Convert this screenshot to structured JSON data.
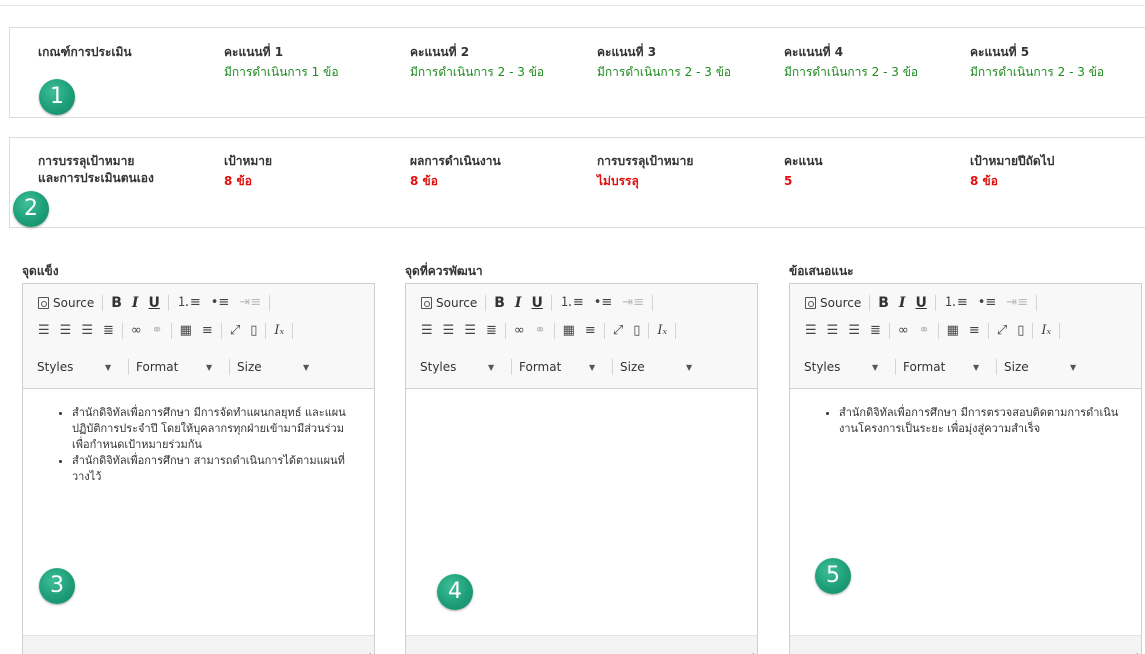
{
  "criteria": {
    "label": "เกณฑ์การประเมิน",
    "scores": [
      {
        "title": "คะแนนที่ 1",
        "desc": "มีการดำเนินการ 1 ข้อ"
      },
      {
        "title": "คะแนนที่ 2",
        "desc": "มีการดำเนินการ 2 - 3 ข้อ"
      },
      {
        "title": "คะแนนที่ 3",
        "desc": "มีการดำเนินการ 2 - 3 ข้อ"
      },
      {
        "title": "คะแนนที่ 4",
        "desc": "มีการดำเนินการ 2 - 3 ข้อ"
      },
      {
        "title": "คะแนนที่ 5",
        "desc": "มีการดำเนินการ 2 - 3 ข้อ"
      }
    ]
  },
  "assessment": {
    "label_line1": "การบรรลุเป้าหมาย",
    "label_line2": "และการประเมินตนเอง",
    "columns": [
      {
        "title": "เป้าหมาย",
        "value": "8 ข้อ"
      },
      {
        "title": "ผลการดำเนินงาน",
        "value": "8 ข้อ"
      },
      {
        "title": "การบรรลุเป้าหมาย",
        "value": "ไม่บรรลุ"
      },
      {
        "title": "คะแนน",
        "value": "5"
      },
      {
        "title": "เป้าหมายปีถัดไป",
        "value": "8 ข้อ"
      }
    ]
  },
  "badges": [
    "1",
    "2",
    "3",
    "4",
    "5"
  ],
  "toolbar": {
    "source": "Source",
    "bold": "B",
    "italic": "I",
    "underline": "U",
    "styles": "Styles",
    "format": "Format",
    "size": "Size",
    "icons": [
      "source-icon",
      "bold-icon",
      "italic-icon",
      "underline-icon",
      "numbered-list-icon",
      "bulleted-list-icon",
      "indent-icon",
      "align-left-icon",
      "align-center-icon",
      "align-right-icon",
      "justify-icon",
      "link-icon",
      "unlink-icon",
      "table-icon",
      "horizontal-line-icon",
      "maximize-icon",
      "show-blocks-icon",
      "remove-format-icon"
    ]
  },
  "editors": [
    {
      "title": "จุดแข็ง",
      "items": [
        "สำนักดิจิทัลเพื่อการศึกษา มีการจัดทำแผนกลยุทธ์ และแผนปฏิบัติการประจำปี  โดยให้บุคลากรทุกฝ่ายเข้ามามีส่วนร่วมเพื่อกำหนดเป้าหมายร่วมกัน",
        "สำนักดิจิทัลเพื่อการศึกษา  สามารถดำเนินการได้ตามแผนที่วางไว้"
      ]
    },
    {
      "title": "จุดที่ควรพัฒนา",
      "items": []
    },
    {
      "title": "ข้อเสนอแนะ",
      "items": [
        "สำนักดิจิทัลเพื่อการศึกษา มีการตรวจสอบติดตามการดำเนินงานโครงการเป็นระยะ เพื่อมุ่งสู่ความสำเร็จ"
      ]
    }
  ]
}
